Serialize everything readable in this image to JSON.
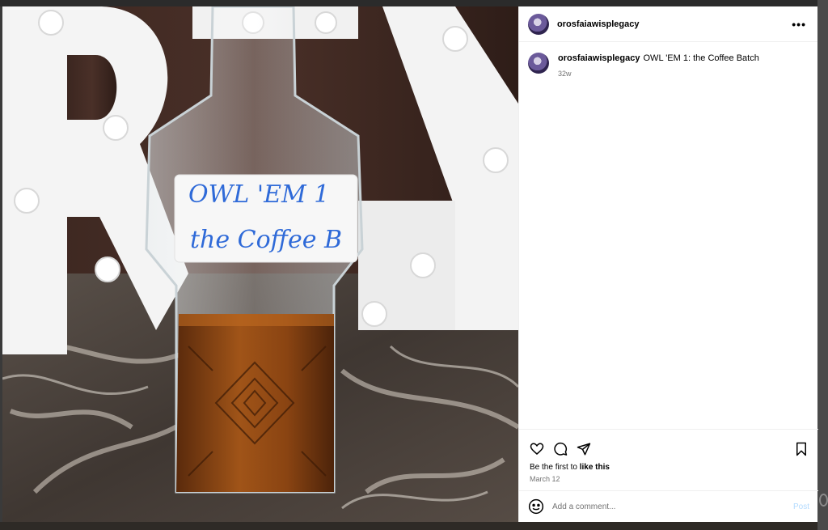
{
  "post": {
    "username": "orosfaiawisplegacy",
    "more_icon": "more-horizontal-icon",
    "caption_user": "orosfaiawisplegacy",
    "caption_text": "OWL 'EM 1: the Coffee Batch",
    "caption_time": "32w",
    "likes_prefix": "Be the first to ",
    "likes_link": "like this",
    "date": "March 12"
  },
  "photo": {
    "label_line1": "OWL 'EM 1",
    "label_line2": "the Coffee B"
  },
  "actions": {
    "icons": [
      "heart-icon",
      "comment-icon",
      "share-icon",
      "bookmark-icon"
    ]
  },
  "comment_box": {
    "placeholder": "Add a comment...",
    "post_label": "Post",
    "post_color": "#b3dbff"
  }
}
